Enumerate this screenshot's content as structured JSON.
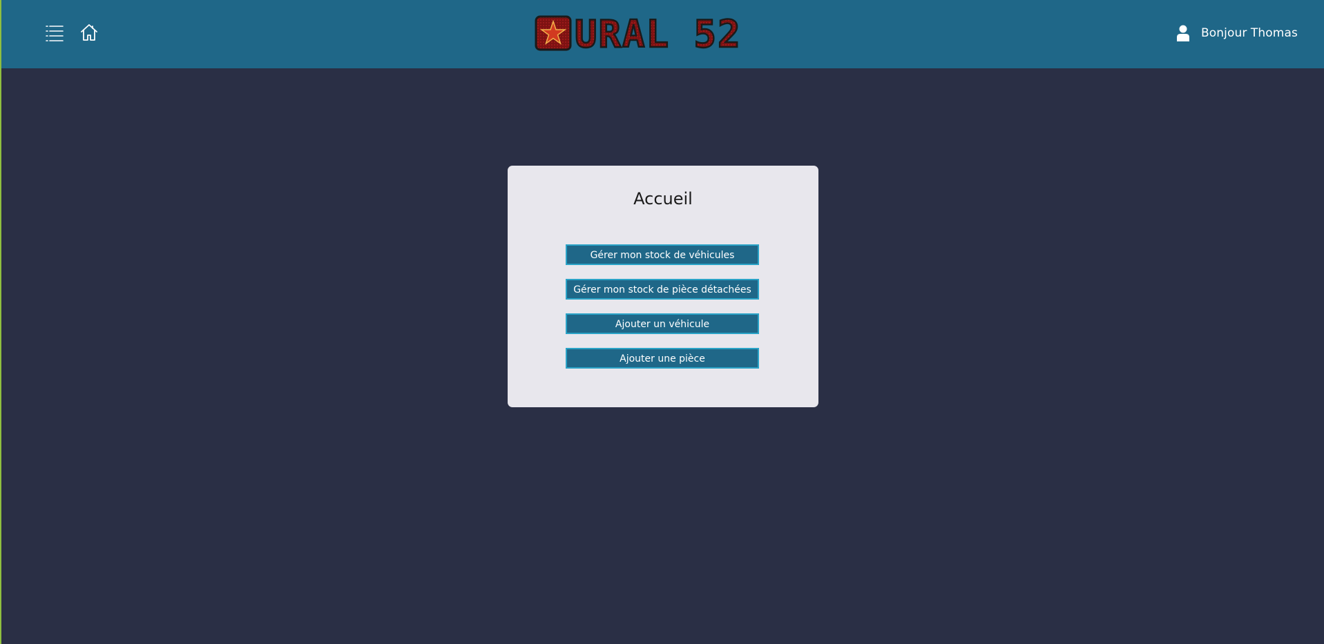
{
  "header": {
    "logo_text": "URAL 52",
    "greeting": "Bonjour Thomas",
    "icons": {
      "menu": "menu-list-icon",
      "home": "home-icon",
      "user": "user-icon",
      "logo_star": "star-icon"
    }
  },
  "main": {
    "title": "Accueil",
    "buttons": [
      {
        "label": "Gérer mon stock de véhicules"
      },
      {
        "label": "Gérer mon stock de pièce détachées"
      },
      {
        "label": "Ajouter un véhicule"
      },
      {
        "label": "Ajouter une pièce"
      }
    ]
  },
  "colors": {
    "header_bg": "#1f6788",
    "page_bg": "#2a2f45",
    "card_bg": "#e8e7ed",
    "button_bg": "#1f6788",
    "button_border": "#2aa3c7",
    "logo_red": "#8c1414"
  }
}
